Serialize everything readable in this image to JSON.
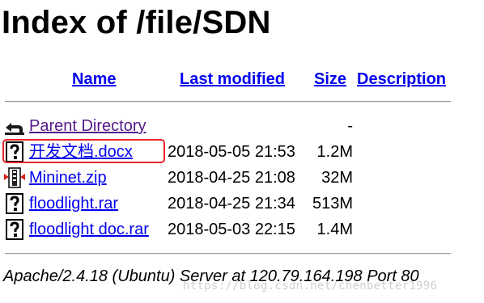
{
  "title": "Index of /file/SDN",
  "columns": {
    "name": "Name",
    "last_modified": "Last modified",
    "size": "Size",
    "description": "Description"
  },
  "parent": {
    "label": "Parent Directory",
    "size": "-",
    "icon": "back-arrow-icon"
  },
  "files": [
    {
      "name": "开发文档.docx",
      "modified": "2018-05-05 21:53",
      "size": "1.2M",
      "icon": "unknown-file-icon"
    },
    {
      "name": "Mininet.zip",
      "modified": "2018-04-25 21:08",
      "size": "32M",
      "icon": "compressed-file-icon"
    },
    {
      "name": "floodlight.rar",
      "modified": "2018-04-25 21:34",
      "size": "513M",
      "icon": "unknown-file-icon"
    },
    {
      "name": "floodlight doc.rar",
      "modified": "2018-05-03 22:15",
      "size": "1.4M",
      "icon": "unknown-file-icon"
    }
  ],
  "footer": "Apache/2.4.18 (Ubuntu) Server at 120.79.164.198 Port 80",
  "watermark": "https://blog.csdn.net/chenbetter1996",
  "colors": {
    "link": "#0000ee",
    "visited_link": "#551a8b",
    "highlight_box": "#e8252a"
  }
}
